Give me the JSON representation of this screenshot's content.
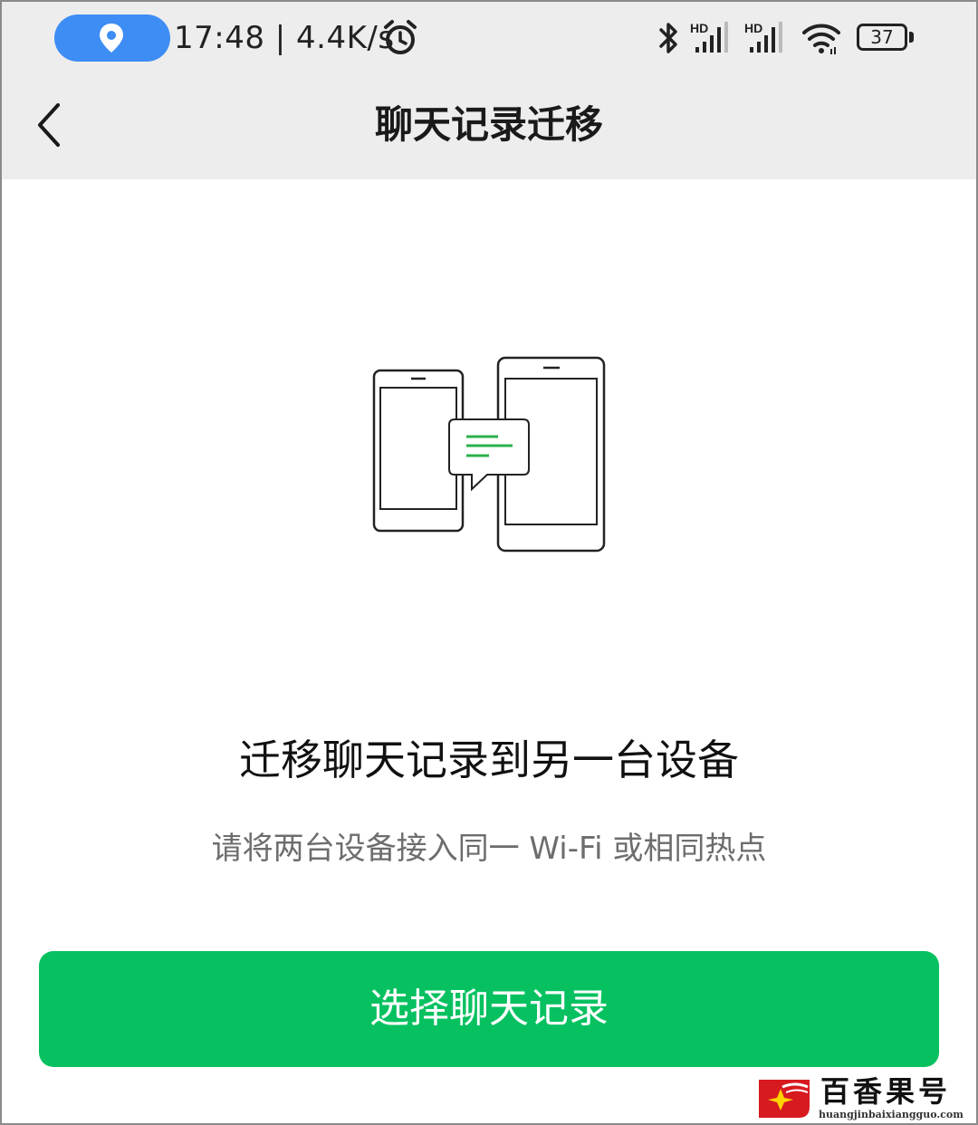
{
  "status_bar": {
    "time_speed": "17:48 | 4.4K/s",
    "signal_1_label": "HD",
    "signal_2_label": "HD",
    "battery_level": "37",
    "location_pill_color": "#3d8df5"
  },
  "nav": {
    "title": "聊天记录迁移",
    "back_icon": "chevron-left-icon"
  },
  "content": {
    "illustration_icon": "two-phones-chat-transfer-icon",
    "headline": "迁移聊天记录到另一台设备",
    "subline": "请将两台设备接入同一 Wi-Fi 或相同热点"
  },
  "actions": {
    "primary_label": "选择聊天记录",
    "primary_color": "#07c160"
  },
  "watermark": {
    "title": "百香果号",
    "domain": "huangjinbaixiangguo.com"
  }
}
